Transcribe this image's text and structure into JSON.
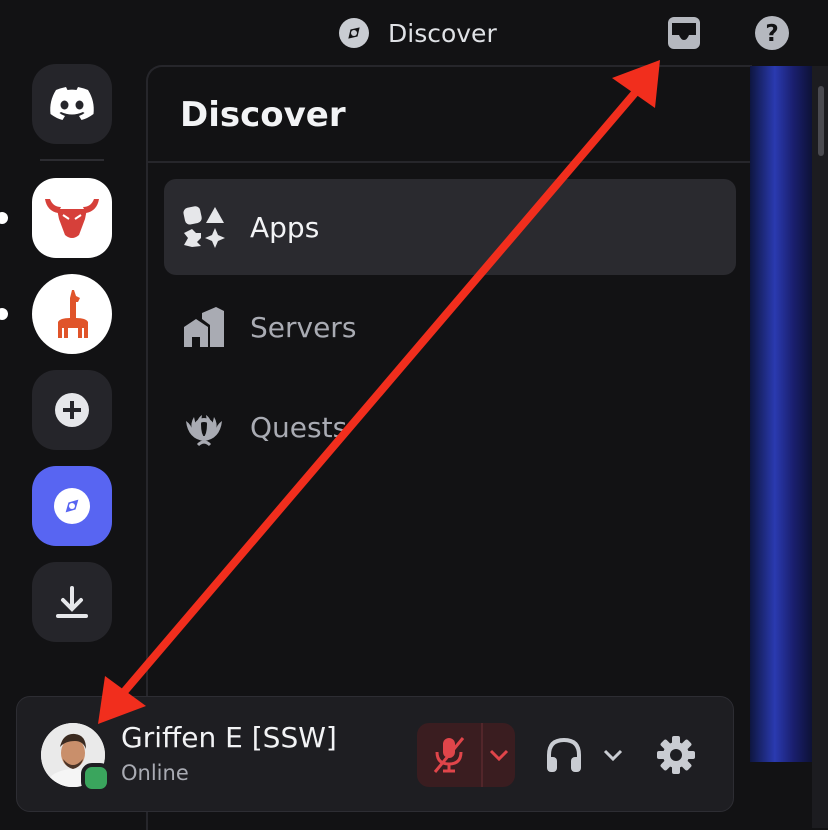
{
  "header": {
    "title": "Discover",
    "title_icon": "compass-icon",
    "inbox_icon": "inbox-icon",
    "help_icon": "help-icon"
  },
  "server_rail": {
    "items": [
      {
        "icon": "discord-logo-icon"
      },
      {
        "icon": "bull-server-icon",
        "unread": true
      },
      {
        "icon": "llama-server-icon",
        "unread": true
      },
      {
        "icon": "add-server-icon"
      },
      {
        "icon": "discover-compass-icon",
        "active": true
      },
      {
        "icon": "download-icon"
      }
    ]
  },
  "discover": {
    "title": "Discover",
    "nav": [
      {
        "label": "Apps",
        "icon": "apps-icon",
        "selected": true
      },
      {
        "label": "Servers",
        "icon": "servers-icon"
      },
      {
        "label": "Quests",
        "icon": "quests-icon"
      }
    ]
  },
  "user": {
    "name": "Griffen E [SSW]",
    "status": "Online",
    "status_color": "#3aa55d",
    "mic_muted": true,
    "mic_icon": "mic-muted-icon",
    "headset_icon": "headphones-icon",
    "settings_icon": "gear-icon"
  },
  "colors": {
    "accent": "#5865f2",
    "annotation_arrow": "#f12e1d",
    "muted_red": "#e0454a"
  }
}
